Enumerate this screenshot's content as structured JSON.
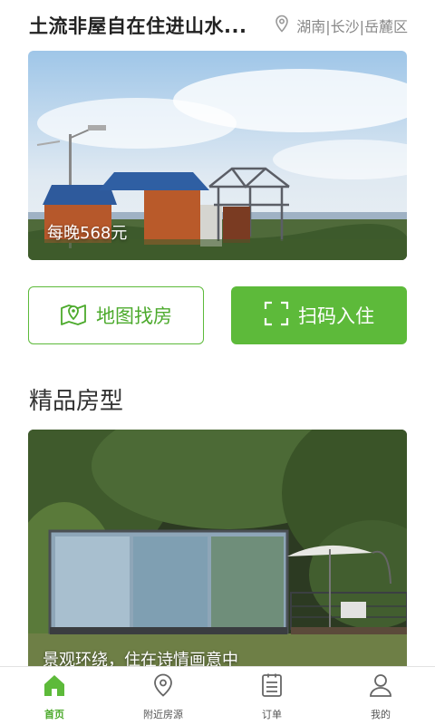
{
  "header": {
    "title": "土流非屋自在住进山水...",
    "location": "湖南|长沙|岳麓区"
  },
  "hero": {
    "price": "每晚568元"
  },
  "actions": {
    "map_label": "地图找房",
    "scan_label": "扫码入住"
  },
  "section": {
    "title": "精品房型"
  },
  "featured": {
    "caption": "景观环绕，住在诗情画意中"
  },
  "tabs": [
    {
      "label": "首页",
      "icon": "home-icon",
      "active": true
    },
    {
      "label": "附近房源",
      "icon": "location-pin-icon",
      "active": false
    },
    {
      "label": "订单",
      "icon": "order-icon",
      "active": false
    },
    {
      "label": "我的",
      "icon": "user-icon",
      "active": false
    }
  ],
  "colors": {
    "accent": "#5dba3a",
    "accent_text": "#4caa2c"
  }
}
